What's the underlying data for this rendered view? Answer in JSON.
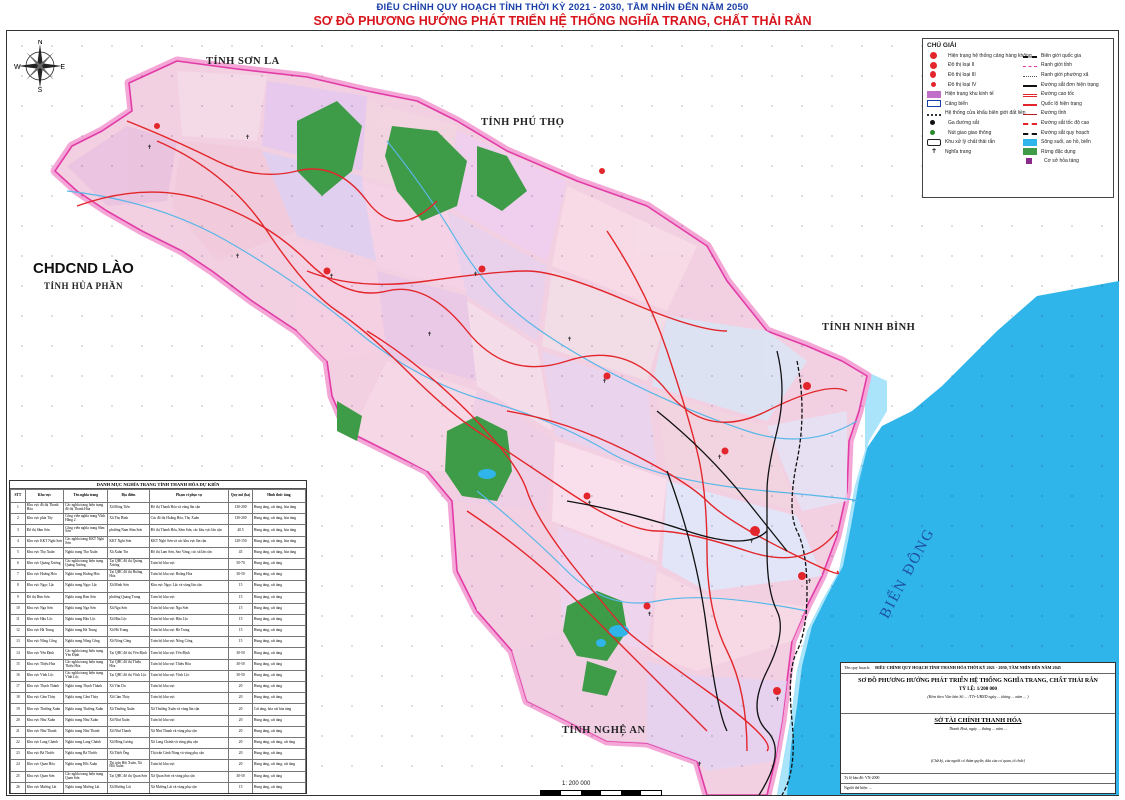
{
  "header": {
    "line1": "ĐIỀU CHỈNH QUY HOẠCH TỈNH THỜI KỲ 2021 - 2030, TẦM NHÌN ĐẾN NĂM 2050",
    "line2": "SƠ ĐỒ PHƯƠNG HƯỚNG PHÁT TRIỂN HỆ THỐNG NGHĨA TRANG, CHẤT THẢI RẮN"
  },
  "compass": {
    "n": "N",
    "s": "S",
    "e": "E",
    "w": "W"
  },
  "map_labels": {
    "son_la": "TỈNH SƠN LA",
    "phu_tho": "TỈNH PHÚ THỌ",
    "lao": "CHDCND LÀO",
    "hua_phan": "TỈNH HỦA PHẦN",
    "ninh_binh": "TỈNH NINH BÌNH",
    "nghe_an": "TỈNH NGHỆ AN",
    "sea": "BIỂN ĐÔNG"
  },
  "colors": {
    "province_border": "#e23ba7",
    "national_border_halo": "#f4a7d6",
    "sea": "#2fb5ea",
    "sea_light": "#a9e4fb",
    "forest": "#3e9b47",
    "road_red": "#e3262b",
    "road_black": "#111111",
    "title_blue": "#1a3fa8",
    "title_red": "#d8141c"
  },
  "legend": {
    "title": "CHÚ GIẢI",
    "left": [
      {
        "icon": "landfill-system-icon",
        "label": "Hiện trạng hệ thống cảng hàng không"
      },
      {
        "icon": "class-ii-city-icon",
        "label": "Đô thị loại II"
      },
      {
        "icon": "class-iii-city-icon",
        "label": "Đô thị loại III"
      },
      {
        "icon": "class-iv-city-icon",
        "label": "Đô thị loại IV"
      },
      {
        "icon": "industrial-zone-icon",
        "label": "Hiện trạng khu kinh tế"
      },
      {
        "icon": "seaport-icon",
        "label": "Cảng biển"
      },
      {
        "icon": "dike-system-icon",
        "label": "Hệ thống cửa khẩu biên giới đất liền"
      },
      {
        "icon": "railway-station-icon",
        "label": "Ga đường sắt"
      },
      {
        "icon": "traffic-node-icon",
        "label": "Nút giao giao thông"
      },
      {
        "icon": "solid-waste-zone-icon",
        "label": "Khu xử lý chất thải rắn"
      },
      {
        "icon": "cemetery-icon",
        "label": "Nghĩa trang"
      }
    ],
    "right": [
      {
        "icon": "national-border-icon",
        "label": "Biên giới quốc gia"
      },
      {
        "icon": "province-border-icon",
        "label": "Ranh giới tỉnh"
      },
      {
        "icon": "ward-border-icon",
        "label": "Ranh giới phường xã"
      },
      {
        "icon": "single-railway-icon",
        "label": "Đường sắt đơn hiện trạng"
      },
      {
        "icon": "expressway-icon",
        "label": "Đường cao tốc"
      },
      {
        "icon": "national-road-icon",
        "label": "Quốc lộ hiện trạng"
      },
      {
        "icon": "provincial-road-icon",
        "label": "Đường tỉnh"
      },
      {
        "icon": "high-speed-railway-icon",
        "label": "Đường sắt tốc độ cao"
      },
      {
        "icon": "planned-railway-icon",
        "label": "Đường sắt quy hoạch"
      },
      {
        "icon": "river-lake-icon",
        "label": "Sông suối, ao hồ, biển"
      },
      {
        "icon": "special-forest-icon",
        "label": "Rừng đặc dụng"
      },
      {
        "icon": "cremation-facility-icon",
        "label": "Cơ sở hỏa táng"
      }
    ]
  },
  "table": {
    "title": "DANH MỤC NGHĨA TRANG TỈNH THANH HÓA DỰ KIẾN",
    "headers": [
      "STT",
      "Khu vực",
      "Tên nghĩa trang",
      "Địa điểm",
      "Phạm vi phục vụ",
      "Quy mô (ha)",
      "Hình thức táng"
    ],
    "rows": [
      [
        "1",
        "Khu vực đô thị Thanh Hóa",
        "Các nghĩa trang hiện trạng đô thị Thanh Hóa",
        "Xã Đông Tiến",
        "Đô thị Thanh Hóa và vùng lân cận",
        "130-200",
        "Hung táng, cát táng, hỏa táng"
      ],
      [
        "2",
        "Khu vực phía Tây",
        "Công viên nghĩa trang Vĩnh Hằng 2",
        "Xã Thọ Bình",
        "Các đô thị Hoằng Hóa, Thọ Xuân",
        "130-200",
        "Hung táng, cát táng, hỏa táng"
      ],
      [
        "3",
        "Đô thị Sầm Sơn",
        "Công viên nghĩa trang Sầm Sơn",
        "phường Nam Sầm Sơn",
        "Đô thị Thanh Hóa, Sầm Sơn, các khu vực lân cận",
        "40.5",
        "Hung táng, cát táng, hỏa táng"
      ],
      [
        "4",
        "Khu vực KKT Nghi Sơn",
        "Các nghĩa trang KKT Nghi Sơn",
        "KKT Nghi Sơn",
        "KKT Nghi Sơn và các khu vực lân cận",
        "120-150",
        "Hung táng, cát táng, hỏa táng"
      ],
      [
        "5",
        "Khu vực Thọ Xuân",
        "Nghĩa trang Thọ Xuân",
        "Xã Xuân Tín",
        "Đô thị Lam Sơn, Sao Vàng, các xã lân cận",
        "45",
        "Hung táng, cát táng, hỏa táng"
      ],
      [
        "6",
        "Khu vực Quảng Xương",
        "Các nghĩa trang hiện trạng Quảng Xương",
        "Tại QHC đô thị Quảng Xương",
        "Toàn bộ khu vực",
        "50-70",
        "Hung táng, cát táng"
      ],
      [
        "7",
        "Khu vực Hoằng Hóa",
        "Nghĩa trang Hoằng Hóa",
        "Tại QHC đô thị Hoằng Hóa",
        "Toàn bộ khu vực Hoằng Hóa",
        "30-50",
        "Hung táng, cát táng"
      ],
      [
        "8",
        "Khu vực Ngọc Lặc",
        "Nghĩa trang Ngọc Lặc",
        "Xã Minh Sơn",
        "Khu vực Ngọc Lặc và vùng lân cận",
        "15",
        "Hung táng, cát táng"
      ],
      [
        "9",
        "Đô thị Bỉm Sơn",
        "Nghĩa trang Bỉm Sơn",
        "phường Quang Trung",
        "Toàn bộ khu vực",
        "15",
        "Hung táng, cát táng"
      ],
      [
        "10",
        "Khu vực Nga Sơn",
        "Nghĩa trang Nga Sơn",
        "Xã Nga Sơn",
        "Toàn bộ khu vực Nga Sơn",
        "15",
        "Hung táng, cát táng"
      ],
      [
        "11",
        "Khu vực Hậu Lộc",
        "Nghĩa trang Hậu Lộc",
        "Xã Hậu Lộc",
        "Toàn bộ khu vực Hậu Lộc",
        "15",
        "Hung táng, cát táng"
      ],
      [
        "12",
        "Khu vực Hà Trung",
        "Nghĩa trang Hà Trung",
        "Xã Hà Trung",
        "Toàn bộ khu vực Hà Trung",
        "15",
        "Hung táng, cát táng"
      ],
      [
        "13",
        "Khu vực Nông Cống",
        "Nghĩa trang Nông Cống",
        "Xã Nông Cống",
        "Toàn bộ khu vực Nông Cống",
        "15",
        "Hung táng, cát táng"
      ],
      [
        "14",
        "Khu vực Yên Định",
        "Các nghĩa trang hiện trạng Yên Định",
        "Tại QHC đô thị Yên Định",
        "Toàn bộ khu vực Yên Định",
        "30-50",
        "Hung táng, cát táng"
      ],
      [
        "15",
        "Khu vực Thiệu Hóa",
        "Các nghĩa trang hiện trạng Thiệu Hóa",
        "Tại QHC đô thị Thiệu Hóa",
        "Toàn bộ khu vực Thiệu Hóa",
        "30-50",
        "Hung táng, cát táng"
      ],
      [
        "16",
        "Khu vực Vĩnh Lộc",
        "Các nghĩa trang hiện trạng Vĩnh Lộc",
        "Tại QHC đô thị Vĩnh Lộc",
        "Toàn bộ khu vực Vĩnh Lộc",
        "30-50",
        "Hung táng, cát táng"
      ],
      [
        "17",
        "Khu vực Thạch Thành",
        "Nghĩa trang Thạch Thành",
        "Xã Vân Du",
        "Toàn bộ khu vực",
        "20",
        "Hung táng, cát táng"
      ],
      [
        "18",
        "Khu vực Cẩm Thủy",
        "Nghĩa trang Cẩm Thủy",
        "Xã Cẩm Thủy",
        "Toàn bộ khu vực",
        "20",
        "Hung táng, cát táng"
      ],
      [
        "19",
        "Khu vực Thường Xuân",
        "Nghĩa trang Thường Xuân",
        "Xã Thường Xuân",
        "Xã Thường Xuân và vùng lân cận",
        "20",
        "Cát táng, hỏa cát hóa táng"
      ],
      [
        "20",
        "Khu vực Như Xuân",
        "Nghĩa trang Như Xuân",
        "Xã Như Xuân",
        "Toàn bộ khu vực",
        "20",
        "Hung táng, cát táng"
      ],
      [
        "21",
        "Khu vực Như Thanh",
        "Nghĩa trang Như Thanh",
        "Xã Như Thanh",
        "Xã Như Thanh và vùng phụ cận",
        "20",
        "Hung táng, cát táng"
      ],
      [
        "22",
        "Khu vực Lang Chánh",
        "Nghĩa trang Lang Chánh",
        "Xã Hồng Lương",
        "Xã Lang Chánh và vùng phụ cận",
        "20",
        "Hung táng, cát táng, cát táng"
      ],
      [
        "23",
        "Khu vực Bá Thước",
        "Nghĩa trang Bá Thước",
        "Xã Thiết Ống",
        "Thị trấn Cành Nàng và vùng phụ cận",
        "20",
        "Hung táng, cát táng"
      ],
      [
        "24",
        "Khu vực Quan Hóa",
        "Nghĩa trang Hồi Xuân",
        "Thị trấn Hồi Xuân, Xã Hồi Xuân",
        "Toàn bộ khu vực",
        "20",
        "Hung táng, cát táng, cát táng"
      ],
      [
        "25",
        "Khu vực Quan Sơn",
        "Các nghĩa trang hiện trạng Quan Sơn",
        "Tại QHC đô thị Quan Sơn",
        "Xã Quan Sơn và vùng phụ cận",
        "30-50",
        "Hung táng, cát táng"
      ],
      [
        "26",
        "Khu vực Mường Lát",
        "Nghĩa trang Mường Lát",
        "Xã Mường Lát",
        "Xã Mường Lát và vùng phụ cận",
        "15",
        "Hung táng, cát táng"
      ]
    ]
  },
  "title_block": {
    "row1_label": "Tên quy hoạch:",
    "row1_value": "ĐIỀU CHỈNH QUY HOẠCH TỈNH THANH HÓA THỜI KỲ 2021 - 2030, TẦM NHÌN ĐẾN NĂM 2045",
    "name": "SƠ ĐỒ PHƯƠNG HƯỚNG PHÁT TRIỂN HỆ THỐNG NGHĨA TRANG, CHẤT THẢI RẮN",
    "scale": "TỶ LỆ: 1/200 000",
    "note": "(Kèm theo Văn bản Số ... /TTr-UBND ngày ... tháng ... năm ... )",
    "agency": "SỞ TÀI CHÍNH THANH HÓA",
    "place": "Thanh Hoá, ngày ... tháng ... năm ...",
    "signer_note": "(Chữ ký, của người có thẩm quyền, dấu của cơ quan, tổ chức)",
    "foot1": "Tỷ lệ bản đồ: VN-2000",
    "foot2": "Người thể hiện: ..."
  },
  "scale_bar": {
    "label": "1: 200 000"
  }
}
